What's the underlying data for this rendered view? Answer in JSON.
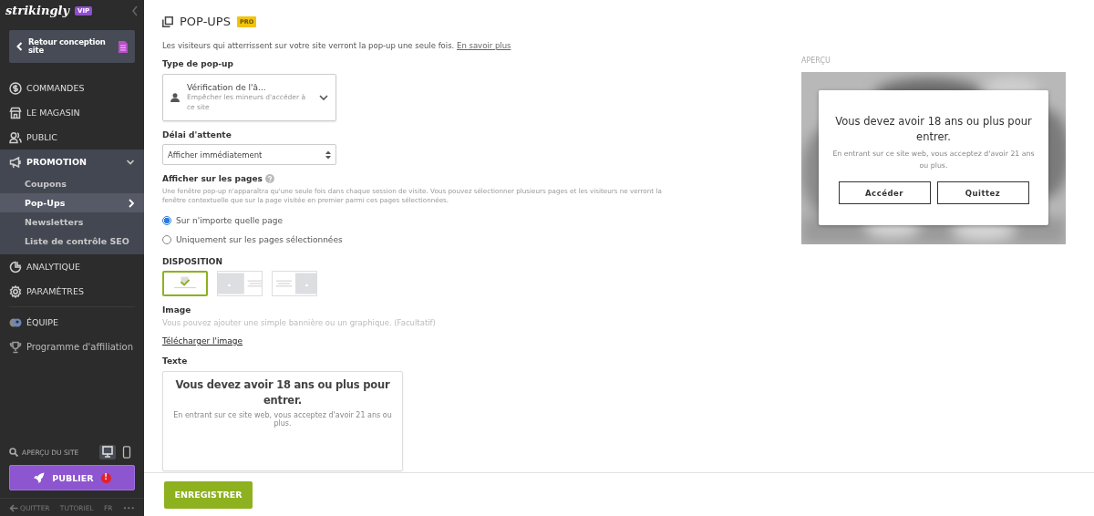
{
  "sidebar": {
    "logo": "strikingly",
    "badge": "VIP",
    "back_button": "Retour conception site",
    "items": [
      {
        "label": "COMMANDES"
      },
      {
        "label": "LE MAGASIN"
      },
      {
        "label": "PUBLIC"
      },
      {
        "label": "PROMOTION",
        "expanded": true,
        "children": [
          {
            "label": "Coupons",
            "selected": false
          },
          {
            "label": "Pop-Ups",
            "selected": true
          },
          {
            "label": "Newsletters",
            "selected": false
          },
          {
            "label": "Liste de contrôle SEO",
            "selected": false
          }
        ]
      },
      {
        "label": "ANALYTIQUE"
      },
      {
        "label": "PARAMÈTRES"
      },
      {
        "label": "ÉQUIPE",
        "divider_before": true
      },
      {
        "label": "Programme d'affiliation"
      }
    ],
    "preview_label": "APERÇU DU SITE",
    "devices": [
      {
        "kind": "desktop",
        "selected": true
      },
      {
        "kind": "mobile",
        "selected": false
      }
    ],
    "publish_button": "PUBLIER",
    "publish_alert": "!",
    "footer_links": [
      "QUITTER",
      "TUTORIEL",
      "FR",
      "•••"
    ]
  },
  "page": {
    "title": "POP-UPS",
    "badge": "PRO",
    "intro": "Les visiteurs qui atterrissent sur votre site verront la pop-up une seule fois.",
    "intro_link": "En savoir plus",
    "type_label": "Type de pop-up",
    "type_value": "Vérification de l'â...",
    "type_description": "Empêcher les mineurs d'accéder à ce site",
    "delay_label": "Délai d'attente",
    "delay_value": "Afficher immédiatement",
    "pages_label": "Afficher sur les pages",
    "pages_help": "Une fenêtre pop-up n'apparaîtra qu'une seule fois dans chaque session de visite. Vous pouvez sélectionner plusieurs pages et les visiteurs ne verront la fenêtre contextuelle que sur la page visitée en premier parmi ces pages sélectionnées.",
    "page_options": [
      {
        "label": "Sur n'importe quelle page",
        "selected": true
      },
      {
        "label": "Uniquement sur les pages sélectionnées",
        "selected": false
      }
    ],
    "layout_label": "DISPOSITION",
    "layouts": [
      {
        "kind": "centered",
        "selected": true
      },
      {
        "kind": "image-left",
        "selected": false
      },
      {
        "kind": "image-right",
        "selected": false
      }
    ],
    "image_label": "Image",
    "image_hint": "Vous pouvez ajouter une simple bannière ou un graphique. (Facultatif)",
    "image_link": "Télécharger l'image",
    "text_label": "Texte",
    "text_heading": "Vous devez avoir 18 ans ou plus pour entrer.",
    "text_body": "En entrant sur ce site web, vous acceptez d'avoir 21 ans ou plus.",
    "save_button": "ENREGISTRER"
  },
  "preview": {
    "label": "APERÇU",
    "heading": "Vous devez avoir 18 ans ou plus pour entrer.",
    "body": "En entrant sur ce site web, vous acceptez d'avoir 21 ans ou plus.",
    "buttons": [
      "Accéder",
      "Quittez"
    ]
  }
}
